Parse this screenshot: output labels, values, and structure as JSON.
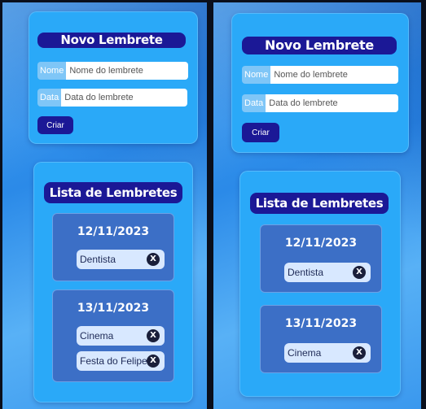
{
  "left": {
    "form": {
      "title": "Novo Lembrete",
      "name_label": "Nome",
      "name_placeholder": "Nome do lembrete",
      "date_label": "Data",
      "date_placeholder": "Data do lembrete",
      "create_label": "Criar"
    },
    "list": {
      "title": "Lista de Lembretes",
      "groups": [
        {
          "date": "12/11/2023",
          "items": [
            {
              "text": "Dentista",
              "delete": "X"
            }
          ]
        },
        {
          "date": "13/11/2023",
          "items": [
            {
              "text": "Cinema",
              "delete": "X"
            },
            {
              "text": "Festa do Felipe",
              "delete": "X"
            }
          ]
        }
      ]
    }
  },
  "right": {
    "form": {
      "title": "Novo Lembrete",
      "name_label": "Nome",
      "name_placeholder": "Nome do lembrete",
      "date_label": "Data",
      "date_placeholder": "Data do lembrete",
      "create_label": "Criar"
    },
    "list": {
      "title": "Lista de Lembretes",
      "groups": [
        {
          "date": "12/11/2023",
          "items": [
            {
              "text": "Dentista",
              "delete": "X"
            }
          ]
        },
        {
          "date": "13/11/2023",
          "items": [
            {
              "text": "Cinema",
              "delete": "X"
            }
          ]
        }
      ]
    }
  },
  "colors": {
    "background_blue": "#2b8ae8",
    "card": "#2aa9f8",
    "title_pill": "#1b1896",
    "group": "#3c6fc6",
    "item": "#d8e8ff",
    "delete_button": "#1a1f3a"
  },
  "icons": {
    "delete": "close-circle-icon"
  }
}
